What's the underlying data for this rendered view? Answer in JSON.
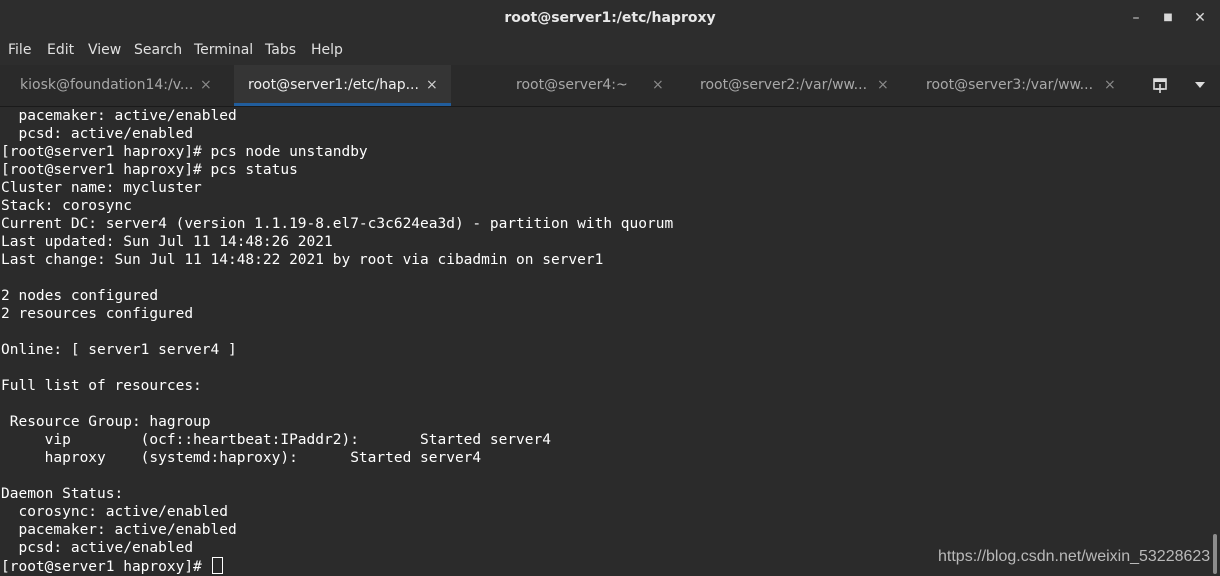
{
  "window": {
    "title": "root@server1:/etc/haproxy",
    "controls": [
      {
        "name": "minimize-icon",
        "glyph": "–"
      },
      {
        "name": "maximize-icon",
        "glyph": "■"
      },
      {
        "name": "close-icon",
        "glyph": "✕"
      }
    ]
  },
  "menu": [
    "File",
    "Edit",
    "View",
    "Search",
    "Terminal",
    "Tabs",
    "Help"
  ],
  "tabs": [
    {
      "label": "kiosk@foundation14:/v...",
      "active": false
    },
    {
      "label": "root@server1:/etc/hap...",
      "active": true
    },
    {
      "label": "root@server4:~",
      "active": false
    },
    {
      "label": "root@server2:/var/ww...",
      "active": false
    },
    {
      "label": "root@server3:/var/ww...",
      "active": false
    }
  ],
  "tab_close_glyph": "×",
  "tab_icons": {
    "new_tab": "new-tab-icon",
    "menu": "chevron-down-icon"
  },
  "terminal": {
    "lines": [
      "  pacemaker: active/enabled",
      "  pcsd: active/enabled",
      "[root@server1 haproxy]# pcs node unstandby",
      "[root@server1 haproxy]# pcs status",
      "Cluster name: mycluster",
      "Stack: corosync",
      "Current DC: server4 (version 1.1.19-8.el7-c3c624ea3d) - partition with quorum",
      "Last updated: Sun Jul 11 14:48:26 2021",
      "Last change: Sun Jul 11 14:48:22 2021 by root via cibadmin on server1",
      "",
      "2 nodes configured",
      "2 resources configured",
      "",
      "Online: [ server1 server4 ]",
      "",
      "Full list of resources:",
      "",
      " Resource Group: hagroup",
      "     vip        (ocf::heartbeat:IPaddr2):       Started server4",
      "     haproxy    (systemd:haproxy):      Started server4",
      "",
      "Daemon Status:",
      "  corosync: active/enabled",
      "  pacemaker: active/enabled",
      "  pcsd: active/enabled"
    ],
    "prompt": "[root@server1 haproxy]# "
  },
  "watermark": "https://blog.csdn.net/weixin_53228623",
  "colors": {
    "accent": "#215d9c",
    "background": "#2b2b2b",
    "text": "#ffffff"
  }
}
